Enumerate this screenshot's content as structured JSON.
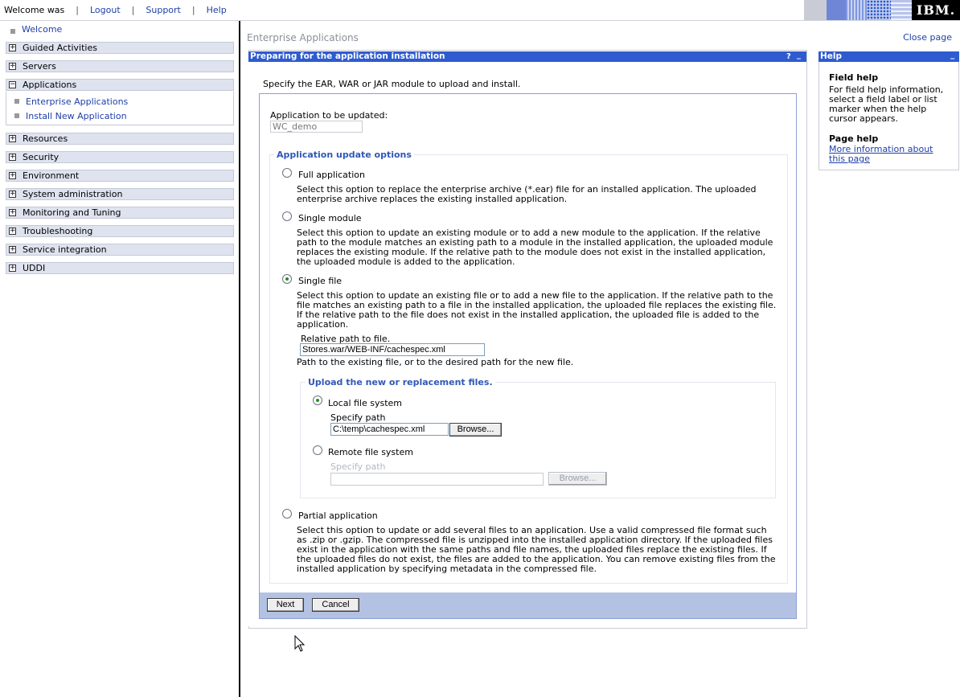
{
  "topbar": {
    "welcome": "Welcome was",
    "sep": "|",
    "logout": "Logout",
    "support": "Support",
    "help": "Help",
    "logo": "IBM."
  },
  "nav": {
    "welcome": "Welcome",
    "groups": [
      "Guided Activities",
      "Servers",
      "Applications",
      "Resources",
      "Security",
      "Environment",
      "System administration",
      "Monitoring and Tuning",
      "Troubleshooting",
      "Service integration",
      "UDDI"
    ],
    "applications_sub": [
      "Enterprise Applications",
      "Install New Application"
    ],
    "plus": "+",
    "minus": "−"
  },
  "main": {
    "breadcrumb": "Enterprise Applications",
    "close_page": "Close page",
    "panel_title": "Preparing for the application installation",
    "panel_help_icon": "?",
    "panel_min_icon": "_",
    "intro": "Specify the EAR, WAR or JAR module to upload and install.",
    "app_label": "Application to be updated:",
    "app_value": "WC_demo",
    "options_legend": "Application update options",
    "options": [
      {
        "label": "Full application",
        "desc": "Select this option to replace the enterprise archive (*.ear) file for an installed application. The uploaded enterprise archive replaces the existing installed application."
      },
      {
        "label": "Single module",
        "desc": "Select this option to update an existing module or to add a new module to the application. If the relative path to the module matches an existing path to a module in the installed application, the uploaded module replaces the existing module. If the relative path to the module does not exist in the installed application, the uploaded module is added to the application."
      },
      {
        "label": "Single file",
        "desc": "Select this option to update an existing file or to add a new file to the application. If the relative path to the file matches an existing path to a file in the installed application, the uploaded file replaces the existing file. If the relative path to the file does not exist in the installed application, the uploaded file is added to the application."
      },
      {
        "label": "Partial application",
        "desc": "Select this option to update or add several files to an application. Use a valid compressed file format such as .zip or .gzip. The compressed file is unzipped into the installed application directory. If the uploaded files exist in the application with the same paths and file names, the uploaded files replace the existing files. If the uploaded files do not exist, the files are added to the application. You can remove existing files from the installed application by specifying metadata in the compressed file."
      }
    ],
    "rel_path_label": "Relative path to file.",
    "rel_path_value": "Stores.war/WEB-INF/cachespec.xml",
    "rel_path_hint": "Path to the existing file, or to the desired path for the new file.",
    "upload_legend": "Upload the new or replacement files.",
    "local_label": "Local file system",
    "local_specify": "Specify path",
    "local_value": "C:\\temp\\cachespec.xml",
    "browse": "Browse...",
    "remote_label": "Remote file system",
    "remote_specify": "Specify path",
    "remote_value": "",
    "next": "Next",
    "cancel": "Cancel"
  },
  "help": {
    "title": "Help",
    "min_icon": "_",
    "field_help_title": "Field help",
    "field_help_text": "For field help information, select a field label or list marker when the help cursor appears.",
    "page_help_title": "Page help",
    "page_help_link": "More information about this page"
  }
}
